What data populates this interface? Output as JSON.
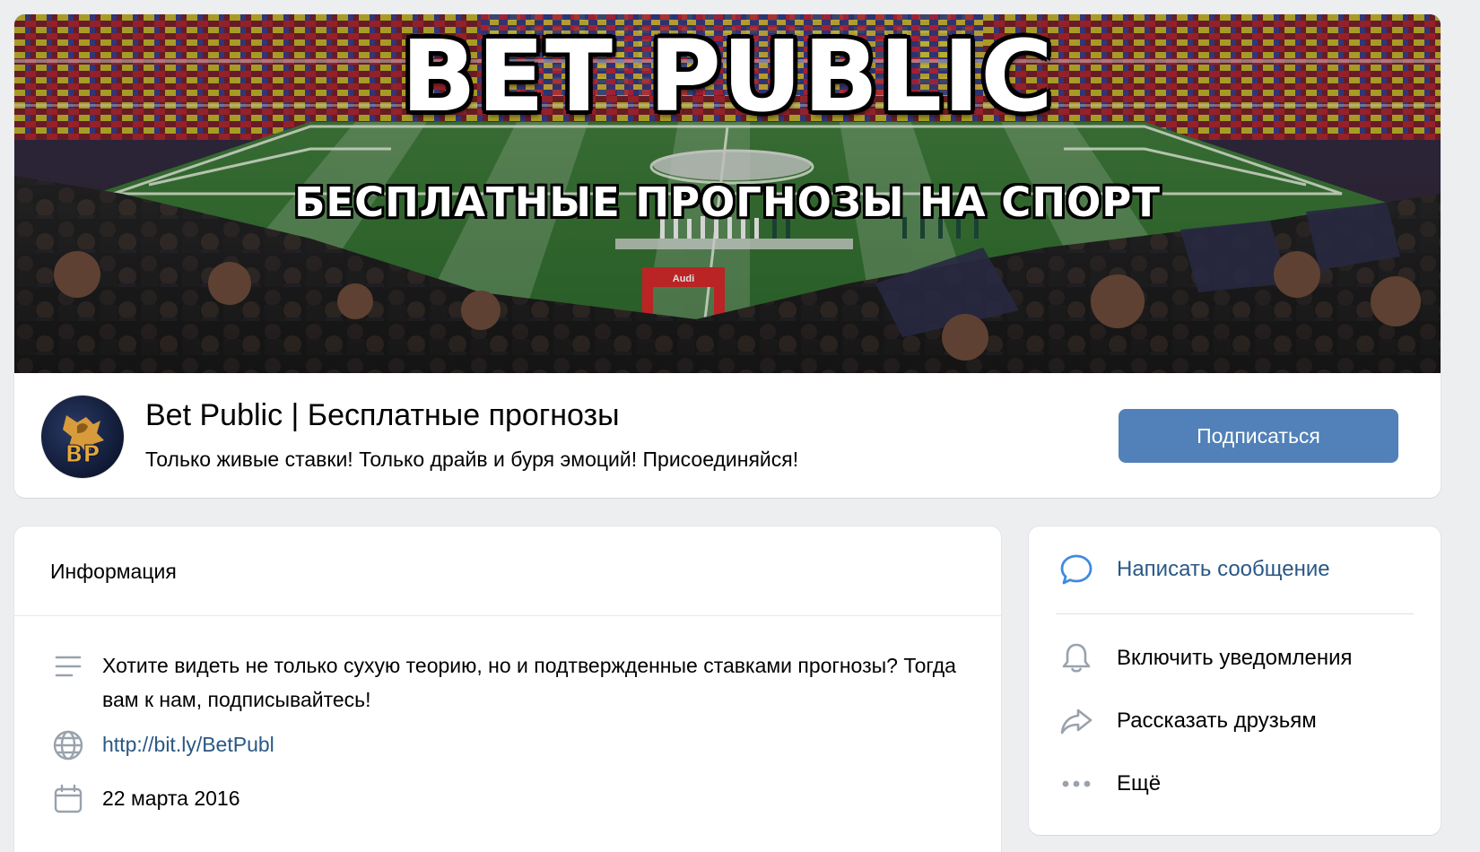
{
  "cover": {
    "title": "BET PUBLIC",
    "subtitle": "БЕСПЛАТНЫЕ ПРОГНОЗЫ НА СПОРТ",
    "ad_board": "Audi"
  },
  "group": {
    "name": "Bet Public | Бесплатные прогнозы",
    "status": "Только живые ставки! Только драйв и буря эмоций! Присоединяйся!",
    "avatar_icon": "bet-public-logo-icon",
    "avatar_letters": "BP",
    "subscribe_label": "Подписаться"
  },
  "info": {
    "title": "Информация",
    "description": "Хотите видеть не только сухую теорию, но и подтвержденные ставками прогнозы? Тогда вам к нам, подписывайтесь!",
    "link": "http://bit.ly/BetPubl",
    "date": "22 марта 2016"
  },
  "actions": {
    "message": "Написать сообщение",
    "notifications": "Включить уведомления",
    "share": "Рассказать друзьям",
    "more": "Ещё"
  },
  "colors": {
    "page_bg": "#edeef0",
    "accent": "#5181b8",
    "link": "#2a5885",
    "icon_gray": "#99a2ad",
    "icon_blue": "#3f8ae0"
  }
}
